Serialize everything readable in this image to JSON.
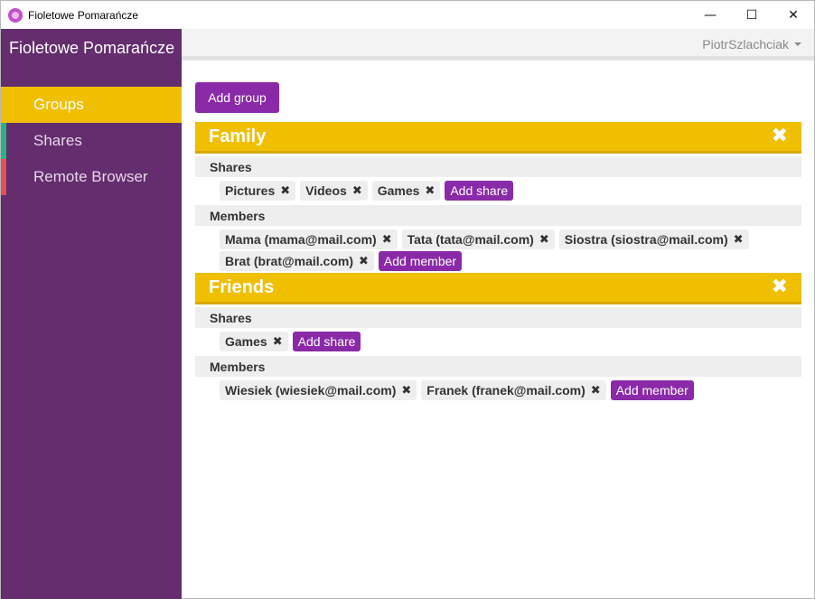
{
  "window": {
    "title": "Fioletowe Pomarańcze",
    "minimize": "—",
    "maximize": "☐",
    "close": "✕"
  },
  "sidebar": {
    "brand": "Fioletowe Pomarańcze",
    "items": [
      {
        "label": "Groups"
      },
      {
        "label": "Shares"
      },
      {
        "label": "Remote Browser"
      }
    ]
  },
  "topbar": {
    "user": "PiotrSzlachciak"
  },
  "main": {
    "add_group_label": "Add group"
  },
  "groups": [
    {
      "name": "Family",
      "close_icon": "✖",
      "shares_label": "Shares",
      "shares": [
        "Pictures",
        "Videos",
        "Games"
      ],
      "add_share_label": "Add share",
      "members_label": "Members",
      "members": [
        "Mama (mama@mail.com)",
        "Tata (tata@mail.com)",
        "Siostra (siostra@mail.com)",
        "Brat (brat@mail.com)"
      ],
      "add_member_label": "Add member"
    },
    {
      "name": "Friends",
      "close_icon": "✖",
      "shares_label": "Shares",
      "shares": [
        "Games"
      ],
      "add_share_label": "Add share",
      "members_label": "Members",
      "members": [
        "Wiesiek (wiesiek@mail.com)",
        "Franek (franek@mail.com)"
      ],
      "add_member_label": "Add member"
    }
  ],
  "remove_icon": "✖",
  "colors": {
    "sidebar": "#642d6e",
    "accent_yellow": "#efbf00",
    "accent_purple": "#8a2aa8",
    "shares_marker": "#27b38a",
    "remote_marker": "#e0515a"
  }
}
